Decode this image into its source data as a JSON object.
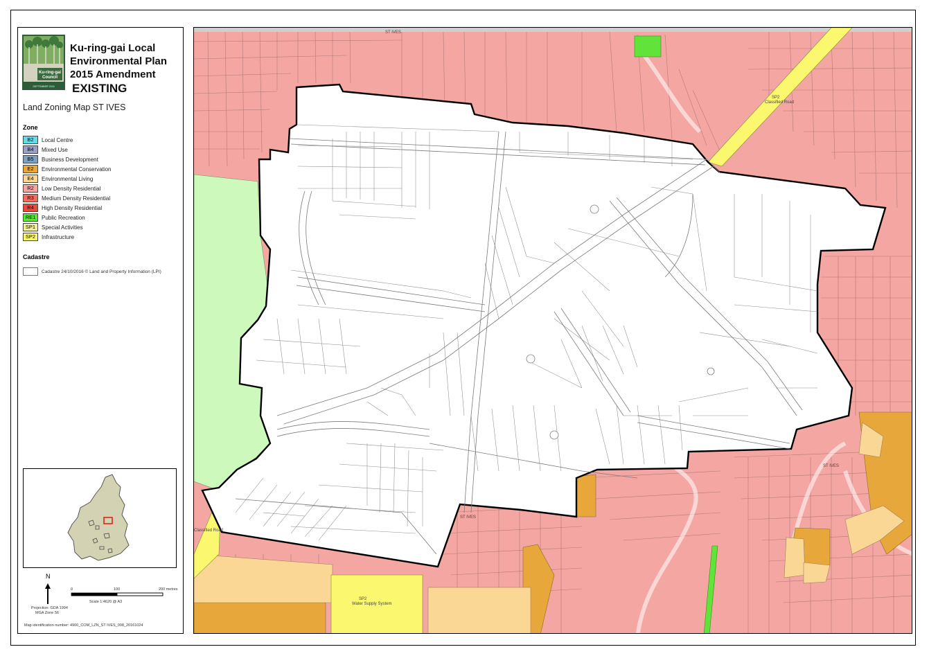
{
  "header": {
    "title_lines": [
      "Ku-ring-gai Local",
      "Environmental Plan",
      "2015 Amendment"
    ],
    "status": "EXISTING",
    "map_title": "Land Zoning Map ST IVES"
  },
  "logo": {
    "council_name_line1": "Ku-ring-gai",
    "council_name_line2": "Council",
    "tagline": "SEPTEMBER 2016"
  },
  "legend": {
    "zone_heading": "Zone",
    "zones": [
      {
        "code": "B2",
        "label": "Local Centre",
        "color": "#66d9e6"
      },
      {
        "code": "B4",
        "label": "Mixed Use",
        "color": "#9aa1c9"
      },
      {
        "code": "B5",
        "label": "Business Development",
        "color": "#7da1c0"
      },
      {
        "code": "E2",
        "label": "Environmental Conservation",
        "color": "#e7a73a"
      },
      {
        "code": "E4",
        "label": "Environmental Living",
        "color": "#fbd796"
      },
      {
        "code": "R2",
        "label": "Low Density Residential",
        "color": "#f4a6a3"
      },
      {
        "code": "R3",
        "label": "Medium Density Residential",
        "color": "#f06e5e"
      },
      {
        "code": "R4",
        "label": "High Density Residential",
        "color": "#e64b3d"
      },
      {
        "code": "RE1",
        "label": "Public Recreation",
        "color": "#62e33a"
      },
      {
        "code": "SP1",
        "label": "Special Activities",
        "color": "#f1f0a0"
      },
      {
        "code": "SP2",
        "label": "Infrastructure",
        "color": "#fbf76e"
      }
    ],
    "cadastre_heading": "Cadastre",
    "cadastre_label": "Cadastre 24/10/2016 © Land and Property Information (LPI)"
  },
  "scale": {
    "north_label": "N",
    "tick_labels": [
      "0",
      "100",
      "200 metres"
    ],
    "scale_text": "Scale   1:4620   @ A3",
    "projection_line1": "Projection: GDA 1994",
    "projection_line2": "MGA Zone 56"
  },
  "map_identification": "Map identification number:   4900_COM_LZN_ST IVES_008_20161024",
  "map_labels": {
    "road_top": "SP2\nClassified Road",
    "road_left": "Classified Road",
    "water": "SP2\nWater Supply System",
    "suburb_top": "ST IVES",
    "suburb_bottom": "ST IVES",
    "suburb_right": "ST IVES"
  },
  "colors": {
    "r2": "#f4a6a3",
    "re1": "#62e33a",
    "re1_light": "#cdf9bd",
    "e2": "#e7a73a",
    "e4": "#fbd796",
    "sp2": "#fbf76e",
    "boundary": "#000000",
    "parcel_line": "#9a9a9a"
  }
}
